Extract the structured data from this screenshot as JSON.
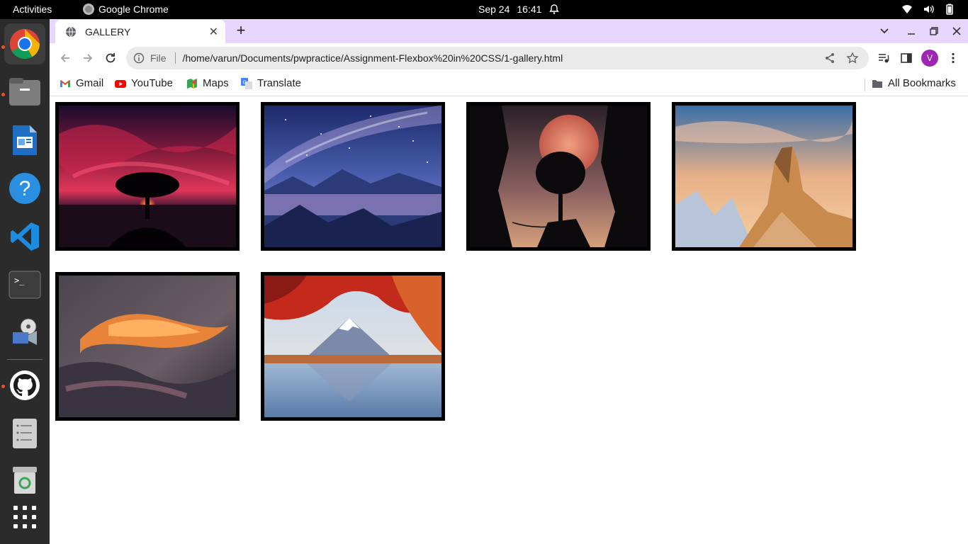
{
  "system": {
    "activities": "Activities",
    "app_name": "Google Chrome",
    "date": "Sep 24",
    "time": "16:41"
  },
  "dock": {
    "items": [
      "chrome-icon",
      "files-icon",
      "writer-icon",
      "help-icon",
      "vscode-icon",
      "terminal-icon",
      "media-icon",
      "github-icon",
      "text-editor-icon",
      "trash-icon",
      "app-grid-icon"
    ]
  },
  "browser": {
    "tab_title": "GALLERY",
    "tab_close": "✕",
    "new_tab": "+",
    "address_scheme": "File",
    "address_url": "/home/varun/Documents/pwpractice/Assignment-Flexbox%20in%20CSS/1-gallery.html",
    "profile_initial": "V",
    "accent_color": "#e9d6ff",
    "profile_color": "#9c27b0"
  },
  "bookmarks": {
    "items": [
      {
        "label": "Gmail",
        "icon": "gmail-icon"
      },
      {
        "label": "YouTube",
        "icon": "youtube-icon"
      },
      {
        "label": "Maps",
        "icon": "maps-icon"
      },
      {
        "label": "Translate",
        "icon": "translate-icon"
      }
    ],
    "all_bookmarks": "All Bookmarks"
  },
  "gallery": {
    "images": [
      {
        "subject": "tree at red sunset"
      },
      {
        "subject": "milky way over mountains"
      },
      {
        "subject": "tree against full moon"
      },
      {
        "subject": "rocky peak at sunset"
      },
      {
        "subject": "orange clouds"
      },
      {
        "subject": "mountain lake with red maple"
      }
    ]
  }
}
